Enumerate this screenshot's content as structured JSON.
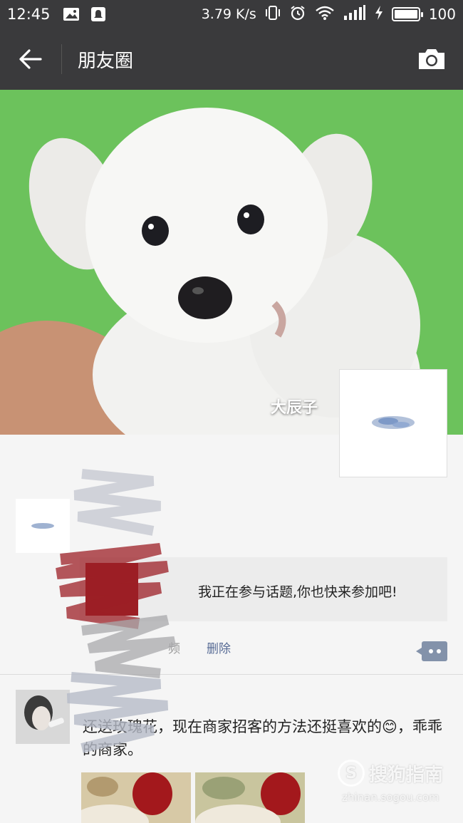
{
  "status_bar": {
    "time": "12:45",
    "net_speed": "3.79 K/s",
    "battery": "100",
    "battery_level": 1.0,
    "icons": [
      "image-icon",
      "notification-icon",
      "vibrate-icon",
      "alarm-icon",
      "wifi-icon",
      "signal-icon",
      "charging-icon",
      "battery-icon"
    ]
  },
  "header": {
    "title": "朋友圈",
    "back_icon": "back-arrow-icon",
    "camera_icon": "camera-icon"
  },
  "cover": {
    "user_name": "大辰子"
  },
  "moment1": {
    "share_text": "我正在参与话题,你也快来参加吧!",
    "meta": "频",
    "delete_label": "删除",
    "comment_icon": "comment-dots-icon"
  },
  "moment2": {
    "text": "还送玫瑰花，现在商家招客的方法还挺喜欢的😊，乖乖的商家。"
  },
  "watermark": {
    "brand": "搜狗指南",
    "url": "zhinan.sogou.com"
  },
  "colors": {
    "header_bg": "#3a3a3c",
    "cover_bg": "#6cc25c",
    "link": "#576b95",
    "comment_btn": "#8392aa"
  }
}
